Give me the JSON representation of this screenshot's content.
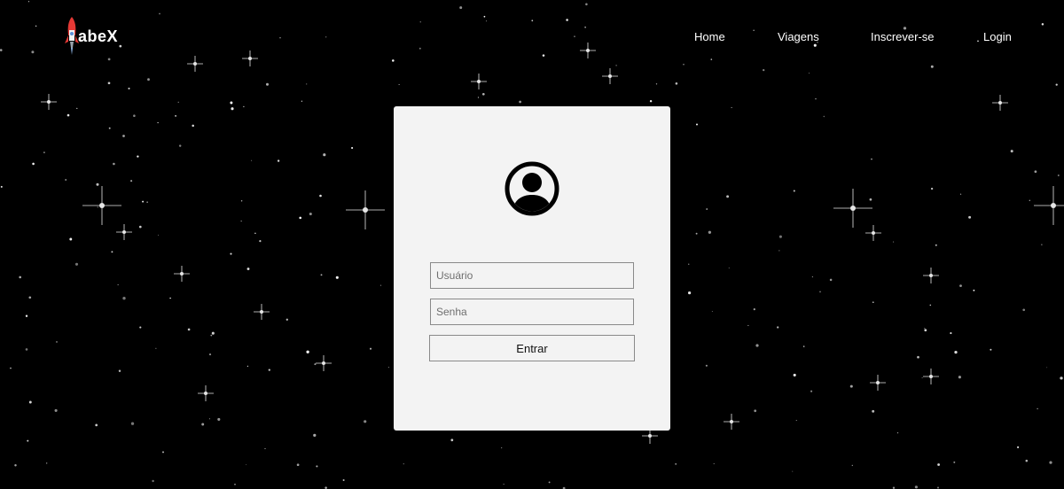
{
  "brand": {
    "name": "abeX",
    "logo_icon": "rocket-icon"
  },
  "nav": {
    "items": [
      {
        "label": "Home"
      },
      {
        "label": "Viagens"
      },
      {
        "label": "Inscrever-se"
      },
      {
        "label": "Login"
      }
    ]
  },
  "login": {
    "avatar_icon": "user-circle-icon",
    "username_placeholder": "Usuário",
    "password_placeholder": "Senha",
    "submit_label": "Entrar"
  },
  "colors": {
    "background": "#000000",
    "card": "#f3f3f3",
    "text_light": "#ffffff",
    "rocket_accent": "#e53935"
  }
}
